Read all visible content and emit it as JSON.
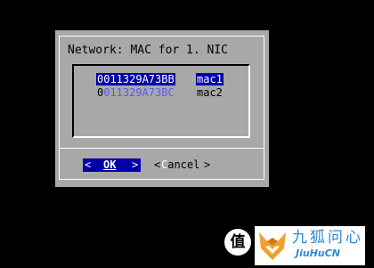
{
  "dialog": {
    "title": "Network: MAC for 1. NIC",
    "list": [
      {
        "mac": "0011329A73BB",
        "iface": "mac1",
        "selected": true
      },
      {
        "mac_hotkey": "0",
        "mac_rest": "011329A73BC",
        "iface": "mac2",
        "selected": false
      }
    ],
    "ok_button": {
      "left": "<",
      "label": "OK",
      "right": ">"
    },
    "cancel_button": {
      "left": "<",
      "hotkey": "C",
      "label_rest": "ancel",
      "right": ">"
    }
  },
  "watermark": {
    "badge": "值",
    "brand_cn": "九狐问心",
    "brand_en": "JiuHuCN"
  },
  "colors": {
    "desktop_bg": "#000000",
    "dialog_bg": "#a8a8a8",
    "highlight_bg": "#0000a8",
    "inactive_text": "#5858fc",
    "brand_blue": "#2a8ad8",
    "brand_orange": "#f0a030"
  }
}
